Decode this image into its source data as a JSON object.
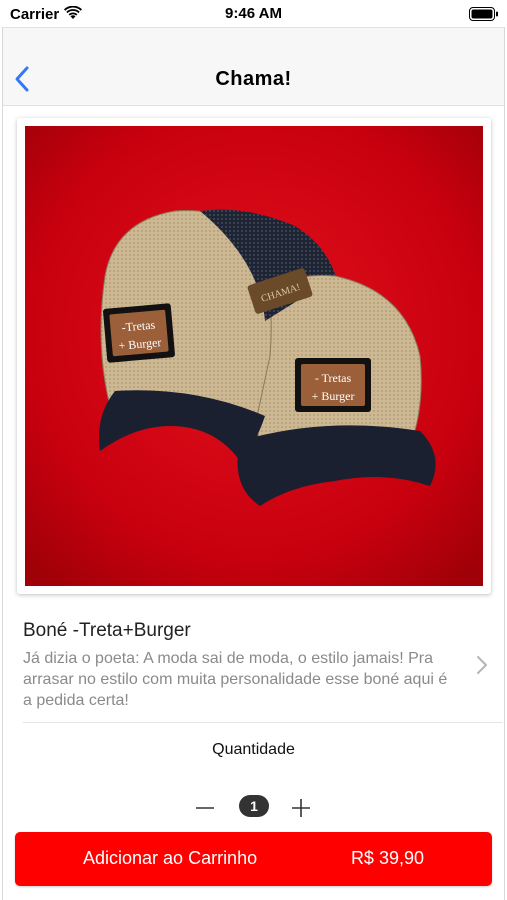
{
  "status_bar": {
    "carrier": "Carrier",
    "time": "9:46 AM"
  },
  "nav": {
    "title": "Chama!"
  },
  "product": {
    "image_badge_left": "-Tretas\n+ Burger",
    "image_badge_right_line1": "- Tretas",
    "image_badge_right_line2": "+ Burger",
    "image_brand": "CHAMA!",
    "name": "Boné -Treta+Burger",
    "description": "Já dizia o poeta: A moda sai de moda, o estilo jamais! Pra arrasar no estilo com muita personalidade esse boné aqui é a pedida certa!"
  },
  "quantity": {
    "label": "Quantidade",
    "value": "1"
  },
  "cart_button": {
    "label": "Adicionar ao Carrinho",
    "price": "R$ 39,90"
  },
  "colors": {
    "accent": "#ff0000",
    "back_arrow": "#3478f6",
    "image_background": "#c8000e"
  },
  "icons": [
    "wifi-icon",
    "battery-icon",
    "back-arrow-icon",
    "chevron-right-icon",
    "minus-icon",
    "plus-icon"
  ]
}
